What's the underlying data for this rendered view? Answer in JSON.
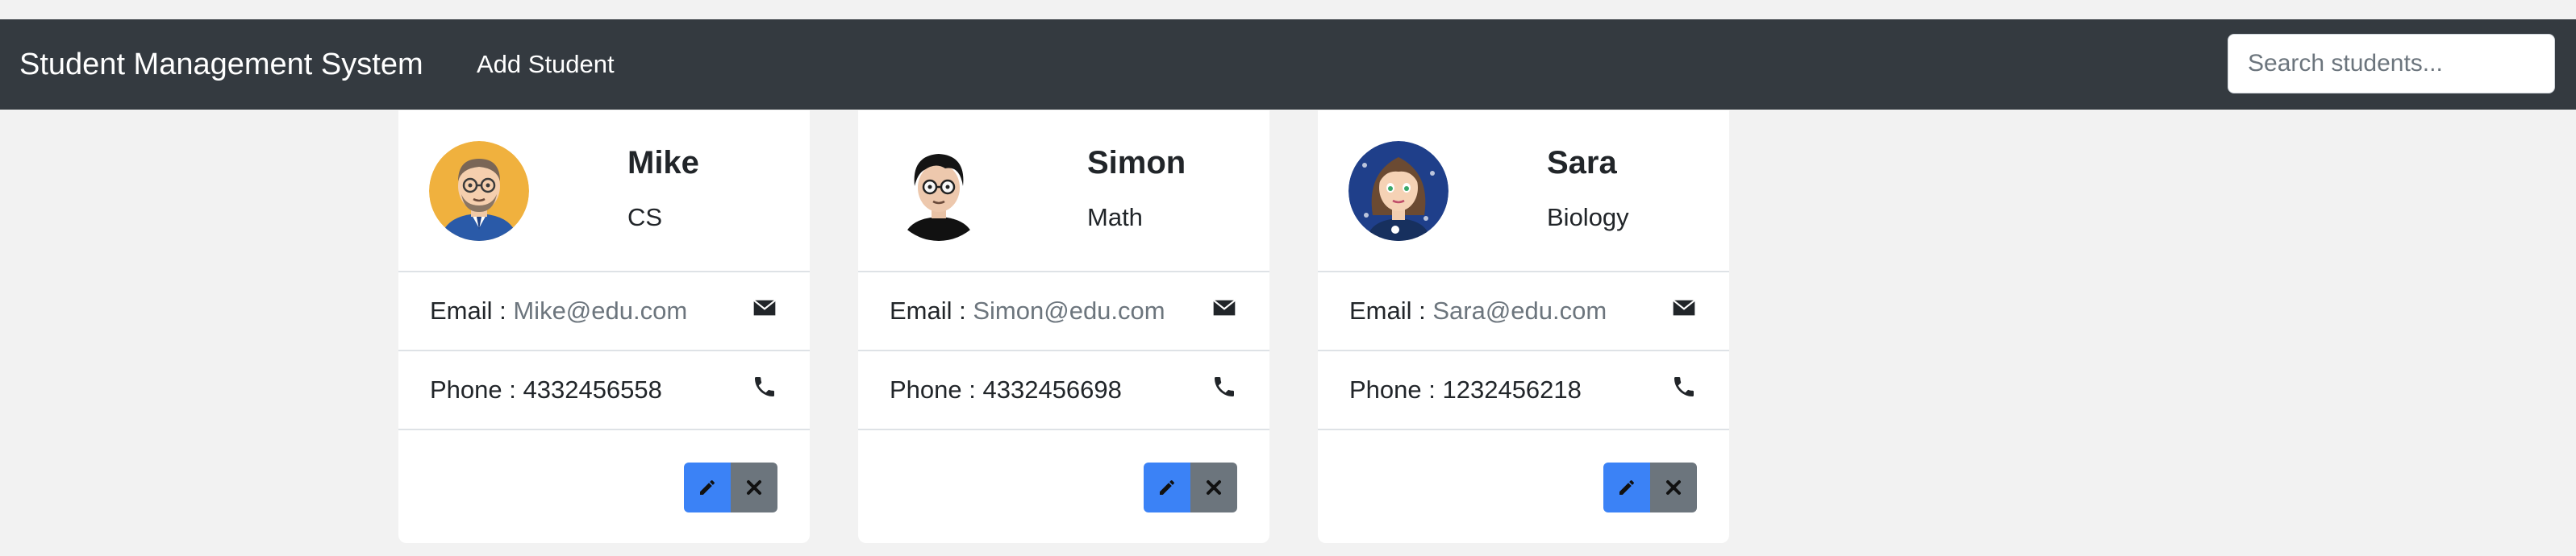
{
  "navbar": {
    "brand": "Student Management System",
    "add_student_label": "Add Student",
    "search_placeholder": "Search students..."
  },
  "email_label": "Email : ",
  "phone_label": "Phone : ",
  "students": [
    {
      "name": "Mike",
      "major": "CS",
      "email": "Mike@edu.com",
      "phone": "4332456558",
      "avatar_icon": "male-avatar-glasses-beard-icon"
    },
    {
      "name": "Simon",
      "major": "Math",
      "email": "Simon@edu.com",
      "phone": "4332456698",
      "avatar_icon": "male-avatar-glasses-black-hair-icon"
    },
    {
      "name": "Sara",
      "major": "Biology",
      "email": "Sara@edu.com",
      "phone": "1232456218",
      "avatar_icon": "female-avatar-icon"
    }
  ],
  "icons": {
    "email": "envelope-icon",
    "phone": "phone-icon",
    "edit": "pencil-icon",
    "delete": "close-icon"
  },
  "colors": {
    "navbar": "#343a40",
    "edit_button": "#3b82f6",
    "delete_button": "#6c757d",
    "page_background": "#f2f2f2"
  }
}
